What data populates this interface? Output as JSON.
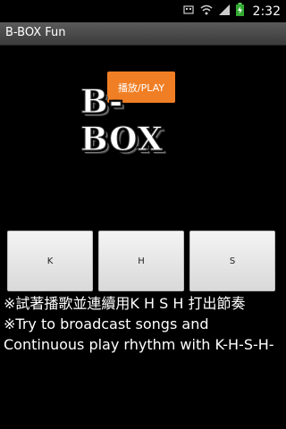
{
  "status_bar": {
    "time": "2:32",
    "icons": [
      "usb-debug-icon",
      "wifi-icon",
      "signal-icon",
      "battery-charging-icon"
    ]
  },
  "app": {
    "title": "B-BOX Fun"
  },
  "play_button": {
    "label": "播放/PLAY"
  },
  "logo": {
    "text": "B-BOX"
  },
  "keys": [
    {
      "label": "K"
    },
    {
      "label": "H"
    },
    {
      "label": "S"
    }
  ],
  "instructions": {
    "chinese": "※試著播歌並連續用K H S H 打出節奏",
    "english": "※Try to broadcast songs and Continuous play rhythm with K-H-S-H-"
  }
}
